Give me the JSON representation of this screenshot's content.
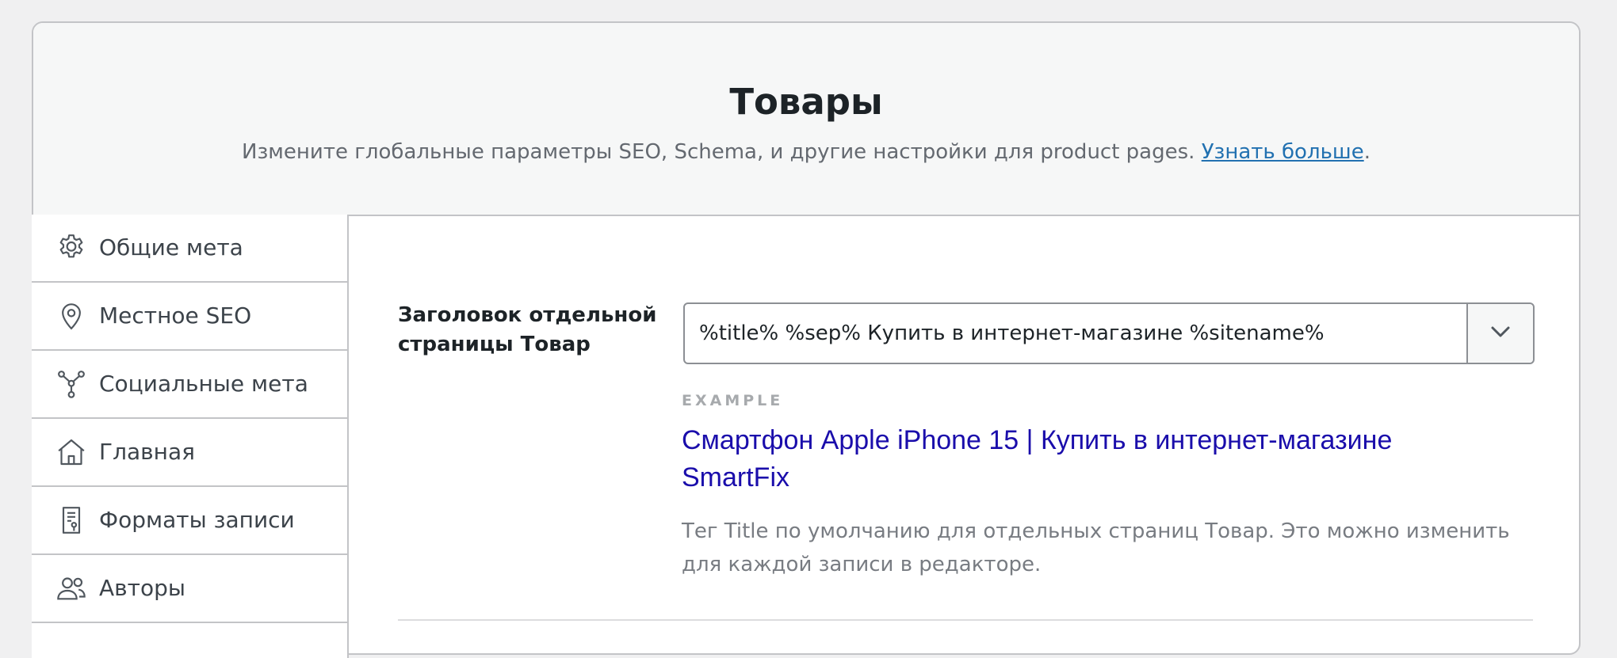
{
  "header": {
    "title": "Товары",
    "description": "Измените глобальные параметры SEO, Schema, и другие настройки для product pages.",
    "learn_more_label": "Узнать больше",
    "description_end": "."
  },
  "sidebar": {
    "items": [
      {
        "label": "Общие мета",
        "icon": "gear-icon"
      },
      {
        "label": "Местное SEO",
        "icon": "location-pin-icon"
      },
      {
        "label": "Социальные мета",
        "icon": "social-network-icon"
      },
      {
        "label": "Главная",
        "icon": "home-icon"
      },
      {
        "label": "Форматы записи",
        "icon": "post-format-icon"
      },
      {
        "label": "Авторы",
        "icon": "users-icon"
      }
    ]
  },
  "field": {
    "label": "Заголовок отдельной страницы Товар",
    "value": "%title% %sep% Купить в интернет-магазине %sitename%",
    "example_label": "EXAMPLE",
    "example_title": "Смартфон Apple iPhone 15 | Купить в интернет-магазине SmartFix",
    "help_text": "Тег Title по умолчанию для отдельных страниц Товар. Это можно изменить для каждой записи в редакторе."
  },
  "colors": {
    "link": "#2271b1",
    "example_title": "#1a0dab",
    "border": "#c3c4c7",
    "header_bg": "#f6f7f7"
  }
}
